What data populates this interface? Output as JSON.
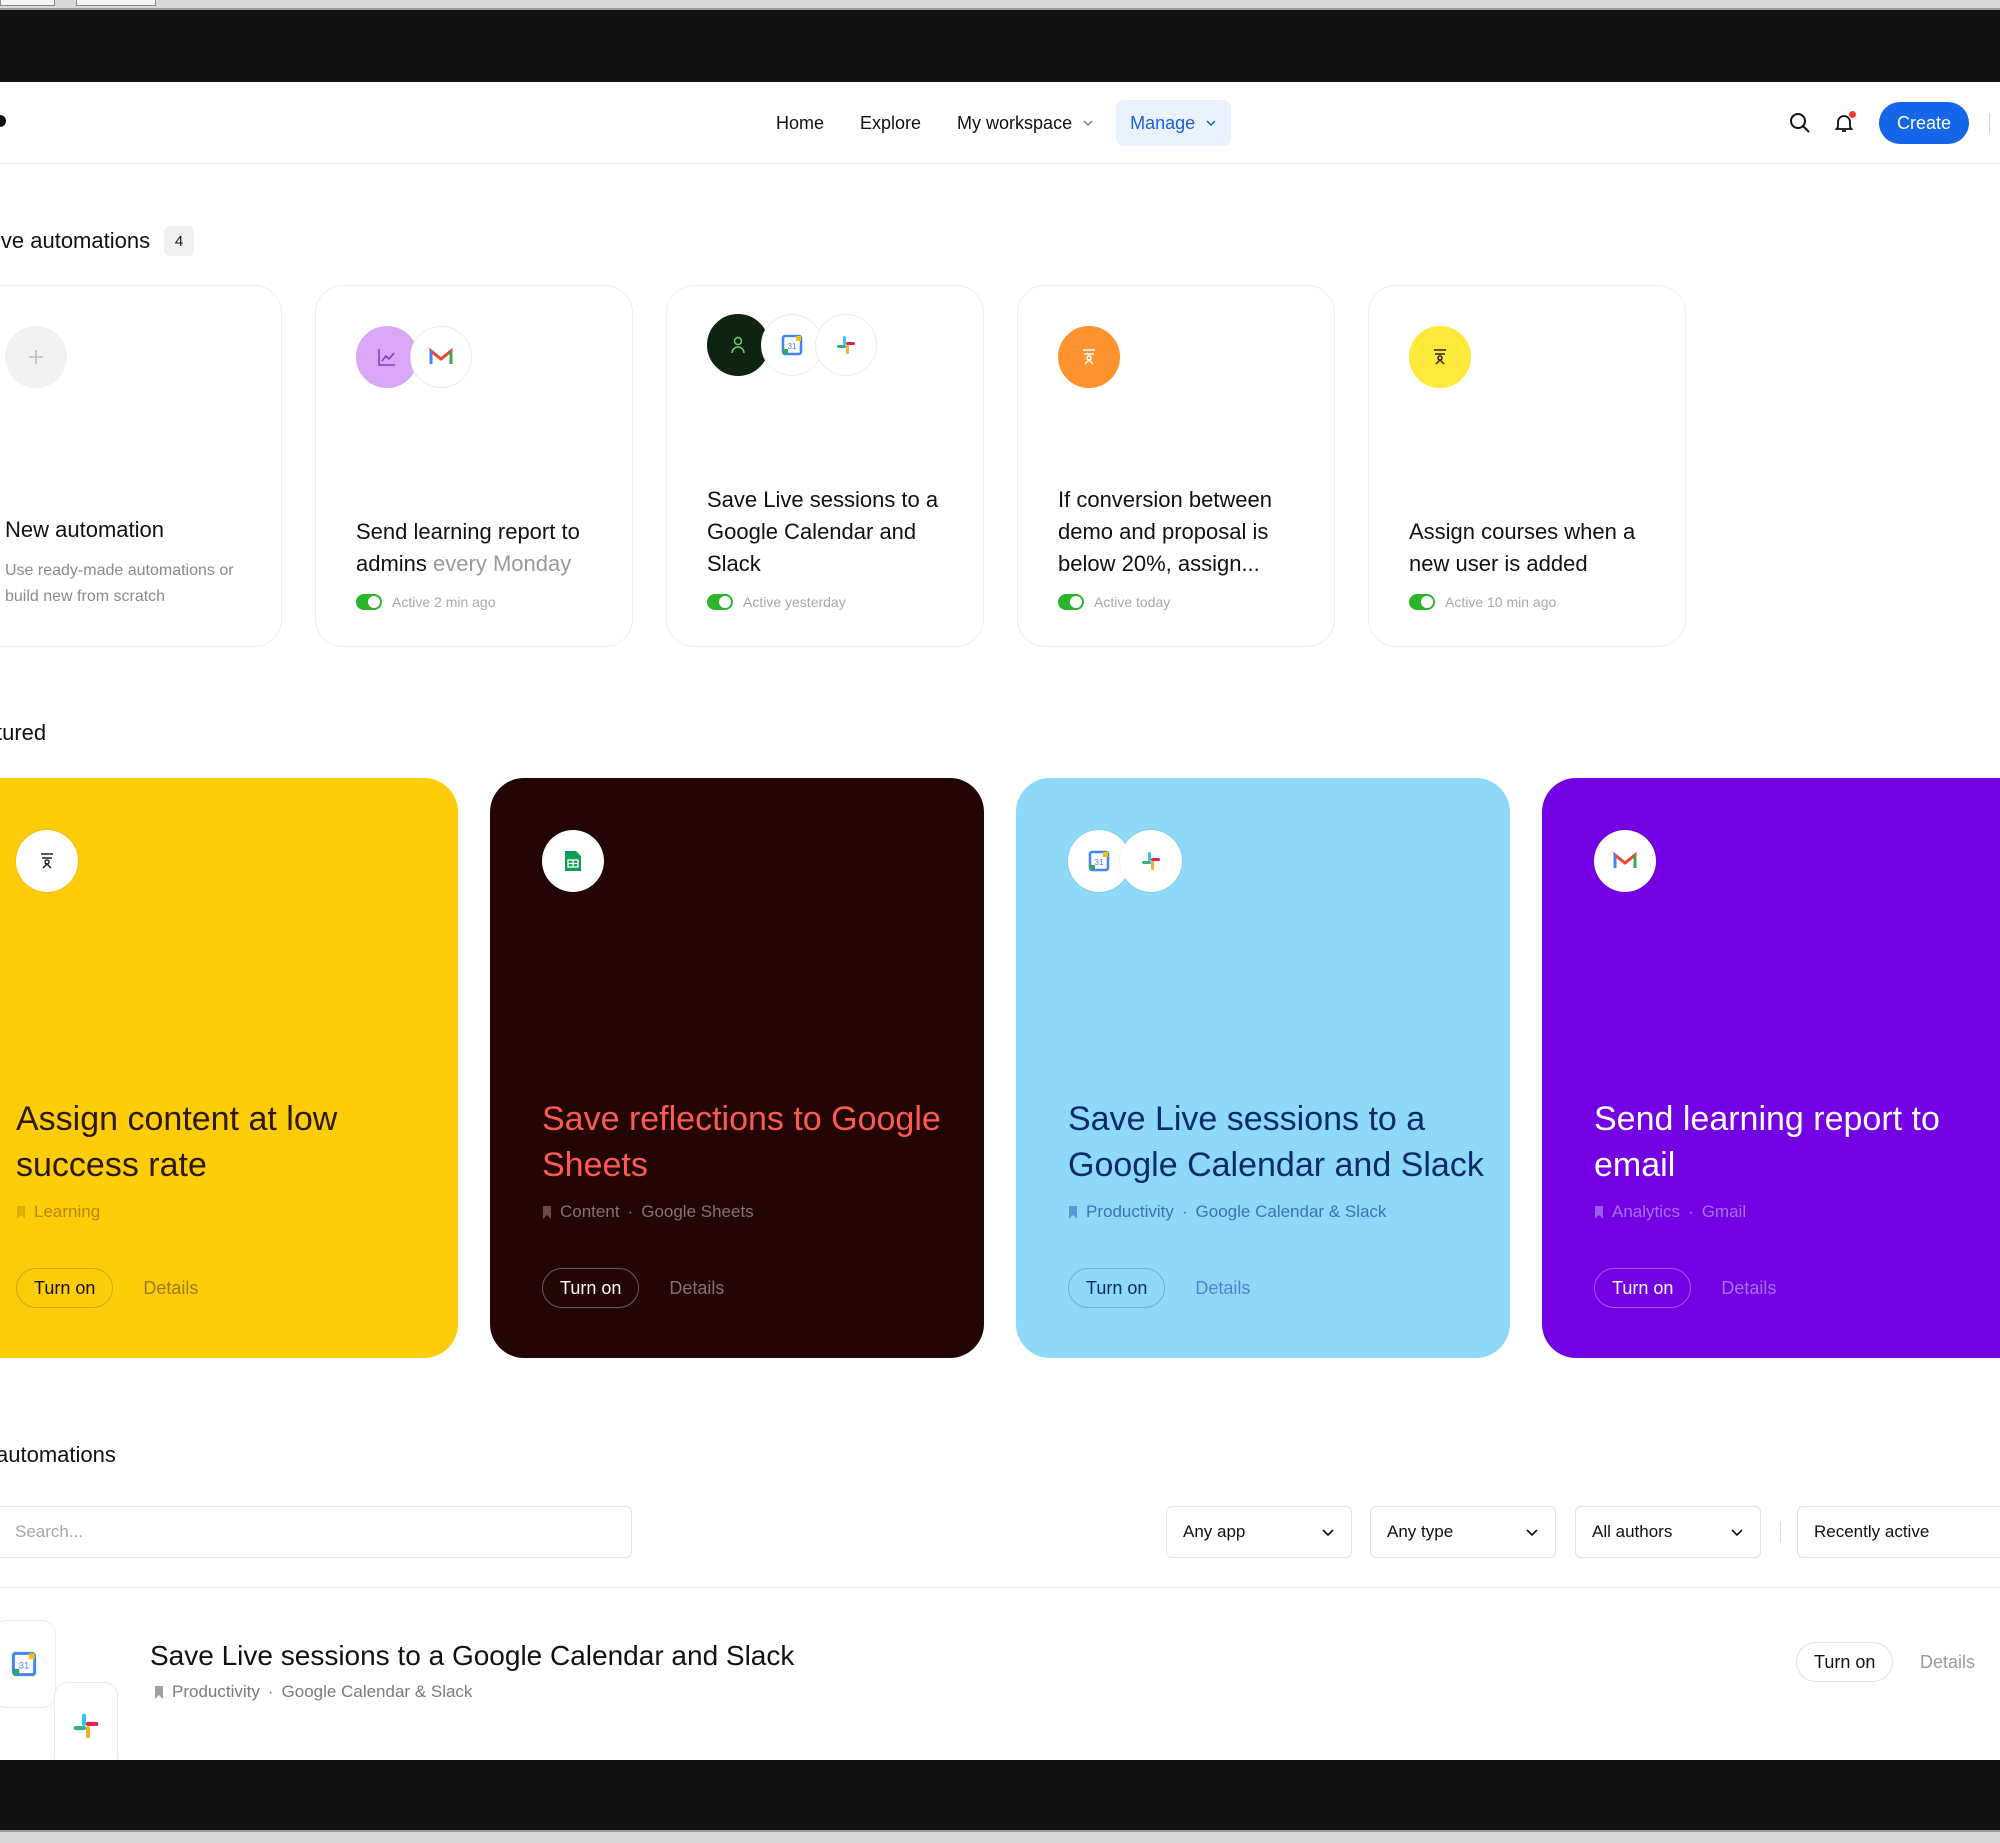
{
  "nav": {
    "items": [
      {
        "label": "Home"
      },
      {
        "label": "Explore"
      },
      {
        "label": "My workspace"
      },
      {
        "label": "Manage"
      }
    ],
    "create_label": "Create"
  },
  "live": {
    "title": "ive automations",
    "count": "4",
    "new_card": {
      "title": "New automation",
      "subtitle": "Use ready-made automations or build new from scratch"
    },
    "cards": [
      {
        "title": "Send learning report to admins",
        "title_suffix": " every Monday",
        "status": "Active 2 min ago"
      },
      {
        "title": "Save Live sessions to a Google Calendar and Slack",
        "status": "Active yesterday"
      },
      {
        "title": "If conversion between demo and proposal is below 20%, assign...",
        "status": "Active today"
      },
      {
        "title": "Assign courses when a new user is added",
        "status": "Active 10 min ago"
      }
    ]
  },
  "featured": {
    "title": "tured",
    "cards": [
      {
        "title": "Assign content at low success rate",
        "category": "Learning",
        "apps": "",
        "turn_on": "Turn on",
        "details": "Details",
        "bg": "#ffcc0a",
        "fg": "#2a1a00"
      },
      {
        "title": "Save reflections to Google Sheets",
        "category": "Content",
        "apps": "Google Sheets",
        "turn_on": "Turn on",
        "details": "Details",
        "bg": "#230505",
        "fg": "#ff5a50"
      },
      {
        "title": "Save Live sessions to a Google Calendar and Slack",
        "category": "Productivity",
        "apps": "Google Calendar & Slack",
        "turn_on": "Turn on",
        "details": "Details",
        "bg": "#8ed8f8",
        "fg": "#0a2a6a"
      },
      {
        "title": "Send learning report to email",
        "category": "Analytics",
        "apps": "Gmail",
        "turn_on": "Turn on",
        "details": "Details",
        "bg": "#7400e4",
        "fg": "#ffffff"
      }
    ]
  },
  "all": {
    "title": "automations",
    "search_placeholder": "Search...",
    "filters": [
      {
        "label": "Any app"
      },
      {
        "label": "Any type"
      },
      {
        "label": "All authors"
      },
      {
        "label": "Recently active"
      }
    ],
    "rows": [
      {
        "title": "Save Live sessions to a Google Calendar and Slack",
        "category": "Productivity",
        "apps": "Google Calendar & Slack",
        "turn_on": "Turn on",
        "details": "Details"
      }
    ]
  }
}
